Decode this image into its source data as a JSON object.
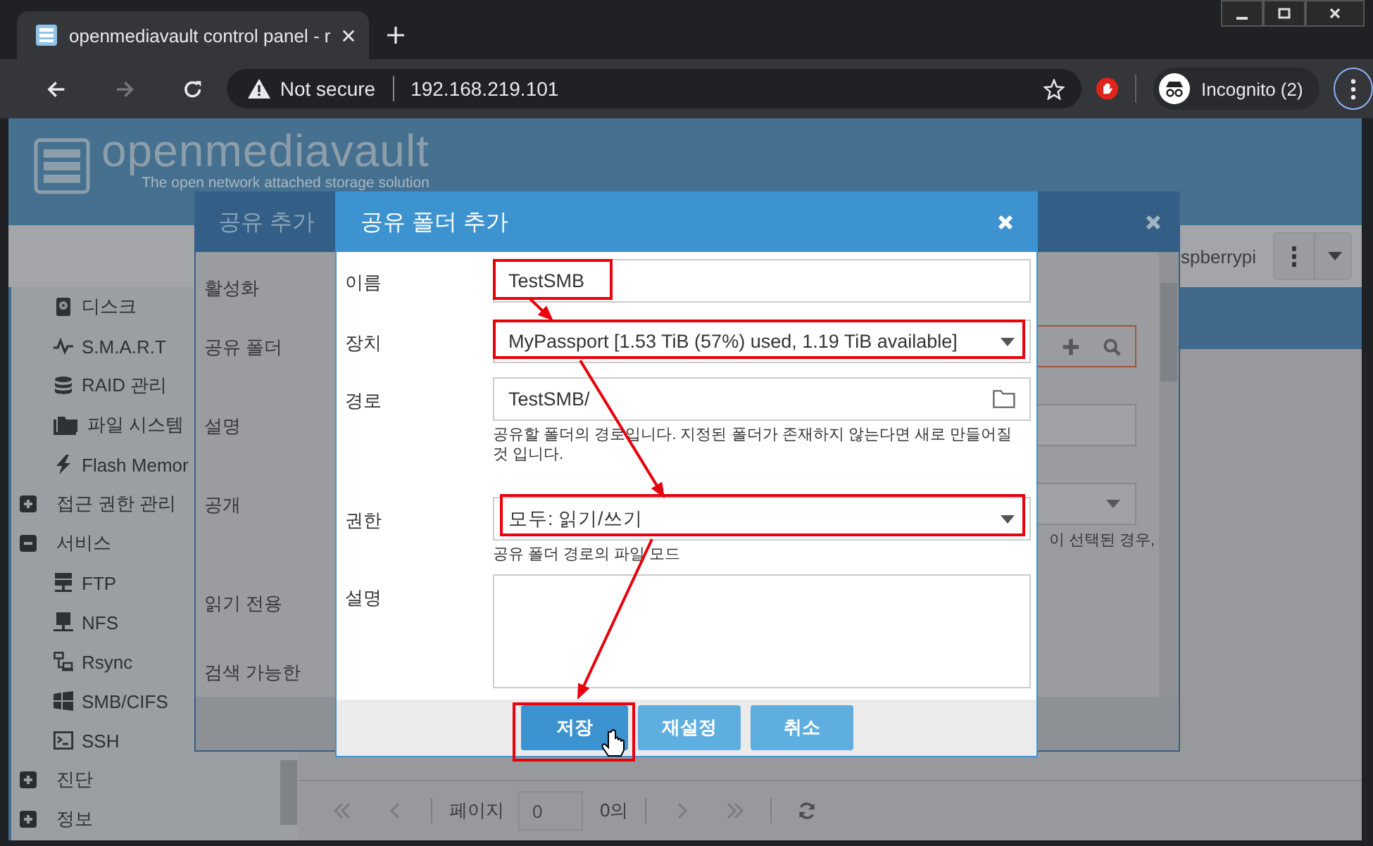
{
  "browser": {
    "tab_title": "openmediavault control panel - r",
    "security": "Not secure",
    "url": "192.168.219.101",
    "profile": "Incognito (2)"
  },
  "app": {
    "logo": "openmediavault",
    "tagline": "The open network attached storage solution",
    "host": "spberrypi"
  },
  "sidebar": [
    {
      "label": "디스크"
    },
    {
      "label": "S.M.A.R.T"
    },
    {
      "label": "RAID 관리"
    },
    {
      "label": "파일 시스템"
    },
    {
      "label": "Flash Memor"
    },
    {
      "label": "접근 권한 관리",
      "expanded": false
    },
    {
      "label": "서비스",
      "expanded": true,
      "children": [
        {
          "label": "FTP"
        },
        {
          "label": "NFS"
        },
        {
          "label": "Rsync"
        },
        {
          "label": "SMB/CIFS"
        },
        {
          "label": "SSH"
        }
      ]
    },
    {
      "label": "진단",
      "expanded": false
    },
    {
      "label": "정보",
      "expanded": false
    }
  ],
  "pager": {
    "label": "페이지",
    "page": "0",
    "of": "0의"
  },
  "background_dialog": {
    "title": "공유 추가",
    "labels": [
      "활성화",
      "공유 폴더",
      "설명",
      "공개",
      "읽기 전용",
      "검색 가능한"
    ],
    "hint_fragment": "이 선택된 경우,"
  },
  "dialog": {
    "title": "공유 폴더 추가",
    "fields": [
      {
        "kind": "text",
        "label": "이름",
        "value": "TestSMB"
      },
      {
        "kind": "select",
        "label": "장치",
        "value": "MyPassport [1.53 TiB (57%) used, 1.19 TiB available]"
      },
      {
        "kind": "path",
        "label": "경로",
        "value": "TestSMB/",
        "hint": "공유할 폴더의 경로입니다. 지정된 폴더가 존재하지 않는다면 새로 만들어질 것 입니다."
      },
      {
        "kind": "select",
        "label": "권한",
        "value": "모두: 읽기/쓰기",
        "hint": "공유 폴더 경로의 파일 모드"
      },
      {
        "kind": "textarea",
        "label": "설명"
      }
    ],
    "buttons": [
      {
        "label": "저장",
        "hovered": true
      },
      {
        "label": "재설정",
        "hovered": false
      },
      {
        "label": "취소",
        "hovered": false
      }
    ]
  }
}
